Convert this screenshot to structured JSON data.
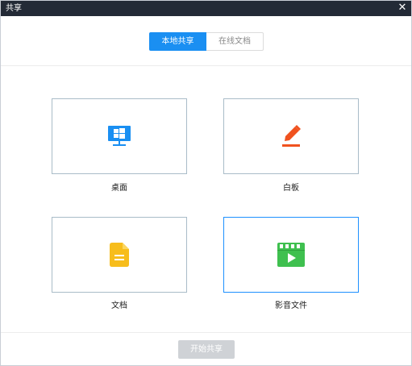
{
  "window": {
    "title": "共享",
    "close_label": "✕"
  },
  "tabs": [
    {
      "label": "本地共享",
      "active": true
    },
    {
      "label": "在线文档",
      "active": false
    }
  ],
  "options": [
    {
      "label": "桌面",
      "icon": "windows-monitor-icon",
      "color": "#1a8ff2",
      "selected": false
    },
    {
      "label": "白板",
      "icon": "pen-icon",
      "color": "#f0521f",
      "selected": false
    },
    {
      "label": "文档",
      "icon": "document-icon",
      "color": "#f7bd1c",
      "selected": false
    },
    {
      "label": "影音文件",
      "icon": "video-clapper-icon",
      "color": "#3fc04f",
      "selected": true
    }
  ],
  "footer": {
    "start_label": "开始共享",
    "start_enabled": false
  }
}
